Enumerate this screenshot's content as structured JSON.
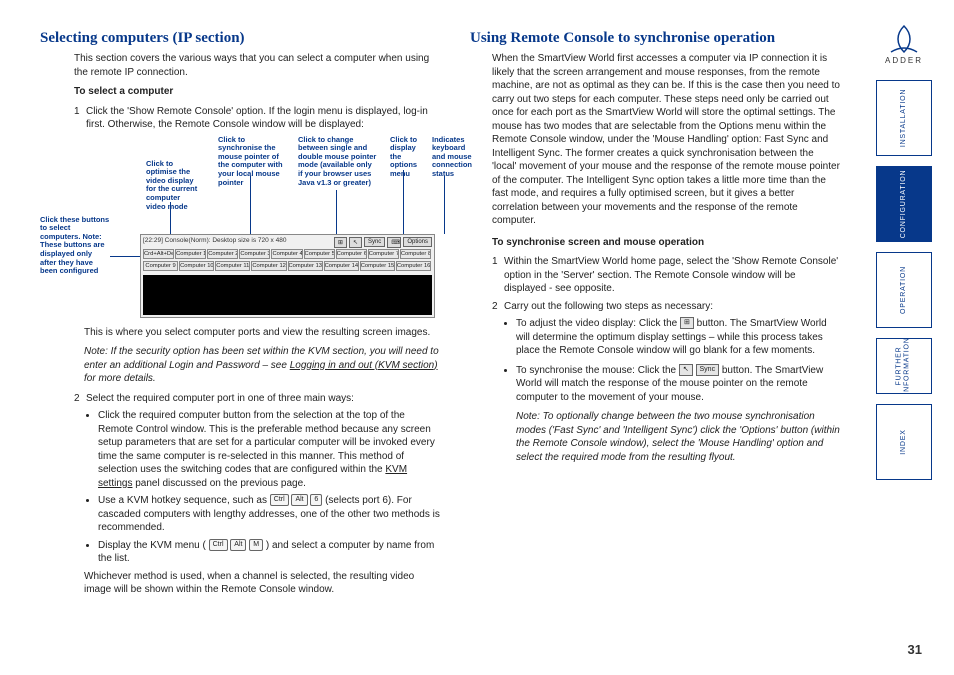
{
  "page_number": "31",
  "logo_text": "ADDER",
  "sidebar": {
    "installation": "INSTALLATION",
    "configuration": "CONFIGURATION",
    "operation": "OPERATION",
    "further_info_1": "FURTHER",
    "further_info_2": "INFORMATION",
    "index": "INDEX"
  },
  "left": {
    "heading": "Selecting computers (IP section)",
    "intro": "This section covers the various ways that you can select a computer when using the remote IP connection.",
    "subhead1": "To select a computer",
    "step1": "Click the 'Show Remote Console' option. If the login menu is displayed, log-in first. Otherwise, the Remote Console window will be displayed:",
    "callouts": {
      "c_left": "Click these buttons to select computers. Note: These buttons are displayed only after they have been configured",
      "c_opt": "Click to optimise the video display for the current computer video mode",
      "c_sync": "Click to synchronise the mouse pointer of the computer with your local mouse pointer",
      "c_mode": "Click to change between single and double mouse pointer mode (available only if your browser uses Java v1.3 or greater)",
      "c_options": "Click to display the options menu",
      "c_status": "Indicates keyboard and mouse connection status"
    },
    "screenshot": {
      "status": "[22:29] Console(Norm): Desktop size is 720 x 480",
      "toolbar_sync": "Sync",
      "toolbar_options": "Options",
      "row1": [
        "Crd+Alt+Delete",
        "Computer 1",
        "Computer 2",
        "Computer 3",
        "Computer 4",
        "Computer 5",
        "Computer 6",
        "Computer 7",
        "Computer 8"
      ],
      "row2": [
        "Computer 9",
        "Computer 10",
        "Computer 11",
        "Computer 12",
        "Computer 13",
        "Computer 14",
        "Computer 15",
        "Computer 16"
      ]
    },
    "after_ss": "This is where you select computer ports and view the resulting screen images.",
    "note_prefix": "Note: If the security option has been set within the KVM section, you will need to enter an additional Login and Password – see ",
    "note_link": "Logging in and out (KVM section)",
    "note_suffix": " for more details.",
    "step2_intro": "Select the required computer port in one of three main ways:",
    "b1_prefix": "Click the required computer button from the selection at the top of the Remote Control window. This is the preferable method because any screen setup parameters that are set for a particular computer will be invoked every time the same computer is re-selected in this manner. This method of selection uses the switching codes that are configured within the ",
    "b1_link": "KVM settings",
    "b1_suffix": " panel discussed on the previous page.",
    "b2_prefix": "Use a KVM hotkey sequence, such as ",
    "b2_k1": "Ctrl",
    "b2_k2": "Alt",
    "b2_k3": "6",
    "b2_suffix": " (selects port 6). For cascaded computers with lengthy addresses, one of the other two methods is recommended.",
    "b3_prefix": "Display the KVM menu (",
    "b3_k1": "Ctrl",
    "b3_k2": "Alt",
    "b3_k3": "M",
    "b3_suffix": ") and select a computer by name from the list.",
    "closing": "Whichever method is used, when a channel is selected, the resulting video image will be shown within the Remote Console window."
  },
  "right": {
    "heading": "Using Remote Console to synchronise operation",
    "intro": "When the SmartView World first accesses a computer via IP connection it is likely that the screen arrangement and mouse responses, from the remote machine, are not as optimal as they can be. If this is the case then you need to carry out two steps for each computer. These steps need only be carried out once for each port as the SmartView World will store the optimal settings. The mouse has two modes that are selectable from the Options menu within the Remote Console window, under the 'Mouse Handling' option: Fast Sync and Intelligent Sync. The former creates a quick synchronisation between the 'local' movement of your mouse and the response of the remote mouse pointer of the computer. The Intelligent Sync option takes a little more time than the fast mode, and requires a fully optimised screen, but it gives a better correlation between your movements and the response of the remote computer.",
    "subhead": "To synchronise screen and mouse operation",
    "step1": "Within the SmartView World home page, select the 'Show Remote Console' option in the 'Server' section. The Remote Console window will be displayed - see opposite.",
    "step2_intro": "Carry out the following two steps as necessary:",
    "b1_prefix": "To adjust the video display: Click the ",
    "b1_suffix": " button. The SmartView World will determine the optimum display settings – while this process takes place the Remote Console window will go blank for a few moments.",
    "b2_prefix": "To synchronise the mouse: Click the ",
    "b2_btn": "Sync",
    "b2_suffix": " button. The SmartView World will match the response of the mouse pointer on the remote computer to the movement of your mouse.",
    "note": "Note: To optionally change between the two mouse synchronisation modes ('Fast Sync' and 'Intelligent Sync') click the 'Options' button (within the Remote Console window), select the 'Mouse Handling' option and select the required mode from the resulting flyout."
  }
}
